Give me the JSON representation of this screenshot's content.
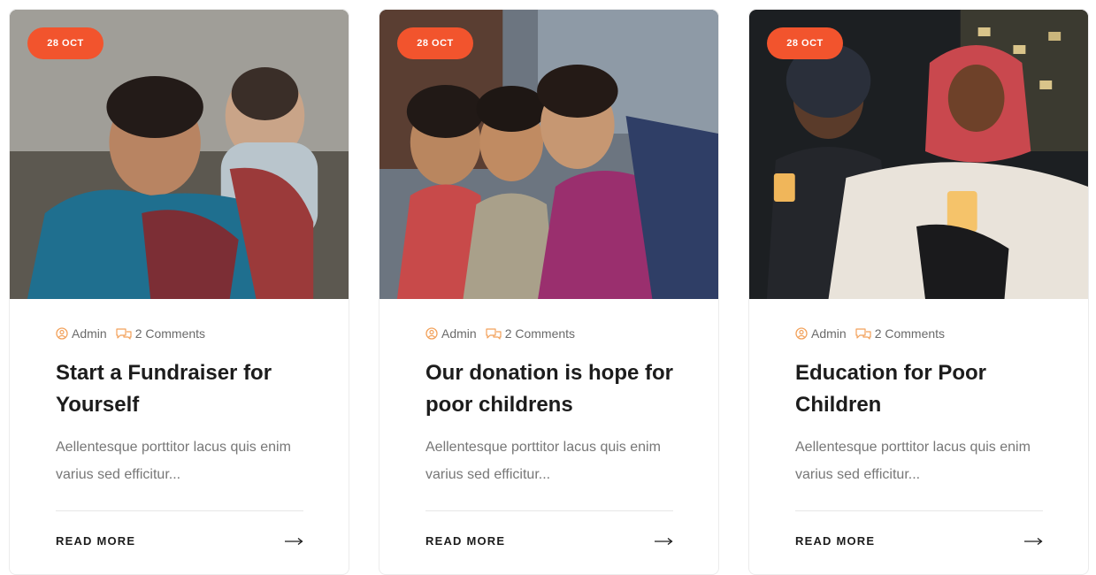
{
  "colors": {
    "accent": "#f2542d",
    "meta_icon": "#f2a15a",
    "title": "#1c1c1c",
    "text": "#777777"
  },
  "cards": [
    {
      "date": "28 OCT",
      "author": "Admin",
      "comments": "2 Comments",
      "title": "Start a Fundraiser for Yourself",
      "excerpt": "Aellentesque porttitor lacus quis enim varius sed efficitur...",
      "read_more": "READ MORE"
    },
    {
      "date": "28 OCT",
      "author": "Admin",
      "comments": "2 Comments",
      "title": "Our donation is hope for poor childrens",
      "excerpt": "Aellentesque porttitor lacus quis enim varius sed efficitur...",
      "read_more": "READ MORE"
    },
    {
      "date": "28 OCT",
      "author": "Admin",
      "comments": "2 Comments",
      "title": "Education for Poor Children",
      "excerpt": "Aellentesque porttitor lacus quis enim varius sed efficitur...",
      "read_more": "READ MORE"
    }
  ]
}
